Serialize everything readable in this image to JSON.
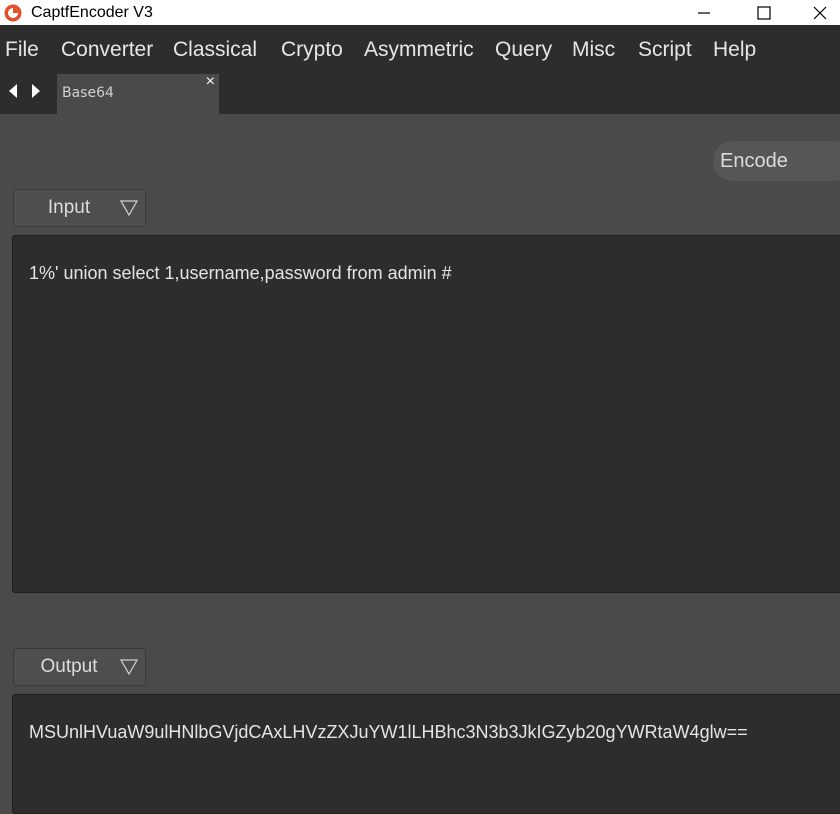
{
  "window": {
    "title": "CaptfEncoder V3",
    "icon": "captfencoder-logo-icon",
    "controls": [
      "minimize-icon",
      "maximize-icon",
      "close-icon"
    ]
  },
  "menu": {
    "items": [
      "File",
      "Converter",
      "Classical",
      "Crypto",
      "Asymmetric",
      "Query",
      "Misc",
      "Script",
      "Help"
    ]
  },
  "tabs": {
    "active": "Base64",
    "close_glyph": "×",
    "nav_icons": [
      "arrow-left-icon",
      "arrow-right-icon"
    ]
  },
  "toolbar": {
    "encode_label": "Encode"
  },
  "input": {
    "mode_label": "Input",
    "text": "1%' union select 1,username,password from admin #"
  },
  "output": {
    "mode_label": "Output",
    "text": "MSUnlHVuaW9ulHNlbGVjdCAxLHVzZXJuYW1lLHBhc3N3b3JkIGZyb20gYWRtaW4glw=="
  },
  "colors": {
    "background": "#4a4a4a",
    "bar": "#2d2d2d",
    "text_area": "#2d2d2d",
    "logo": "#e0502a"
  }
}
